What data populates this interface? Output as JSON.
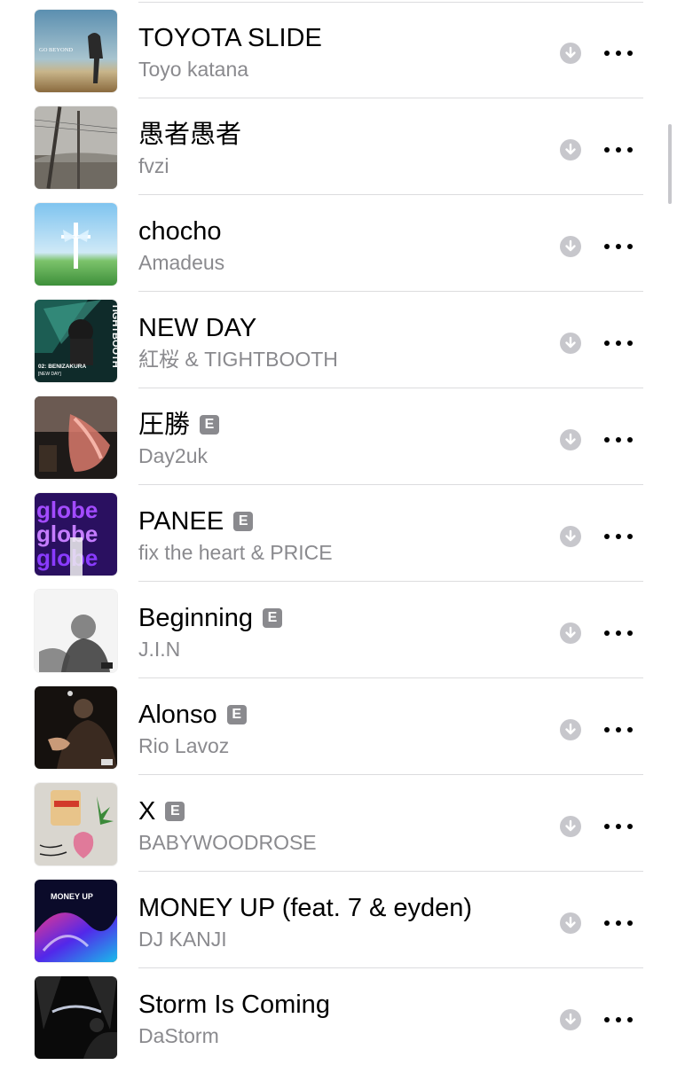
{
  "tracks": [
    {
      "title": "TOYOTA SLIDE",
      "artist": "Toyo katana",
      "explicit": false,
      "artwork_text": "GO BEYOND"
    },
    {
      "title": "愚者愚者",
      "artist": "fvzi",
      "explicit": false
    },
    {
      "title": "chocho",
      "artist": "Amadeus",
      "explicit": false
    },
    {
      "title": "NEW DAY",
      "artist": "紅桜 & TIGHTBOOTH",
      "explicit": false,
      "artwork_text": "TIGHTBOOTH",
      "artwork_subtext": "02: BENIZAKURA",
      "artwork_caption": "[NEW DAY]"
    },
    {
      "title": "圧勝",
      "artist": "Day2uk",
      "explicit": true
    },
    {
      "title": "PANEE",
      "artist": "fix the heart & PRICE",
      "explicit": true,
      "artwork_text": "globe"
    },
    {
      "title": "Beginning",
      "artist": "J.I.N",
      "explicit": true
    },
    {
      "title": "Alonso",
      "artist": "Rio Lavoz",
      "explicit": true
    },
    {
      "title": "X",
      "artist": "BABYWOODROSE",
      "explicit": true
    },
    {
      "title": "MONEY UP (feat. 7 & eyden)",
      "artist": "DJ KANJI",
      "explicit": false,
      "artwork_text": "MONEY UP"
    },
    {
      "title": "Storm Is Coming",
      "artist": "DaStorm",
      "explicit": false
    }
  ],
  "explicit_badge": "E",
  "icons": {
    "download": "download-arrow-circle-icon",
    "more": "ellipsis-icon"
  },
  "colors": {
    "title": "#000000",
    "subtitle": "#8a8a8e",
    "divider": "#dcdcde",
    "badge": "#8a8a8e"
  }
}
